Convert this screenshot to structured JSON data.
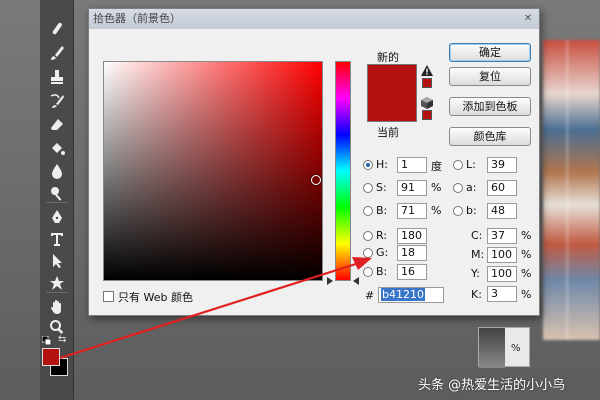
{
  "dialog": {
    "title": "拾色器（前景色）",
    "new_label": "新的",
    "current_label": "当前",
    "web_only_label": "只有 Web 颜色",
    "buttons": {
      "ok": "确定",
      "reset": "复位",
      "add_to_swatches": "添加到色板",
      "color_libraries": "颜色库"
    },
    "hsb": [
      {
        "label": "H:",
        "value": "1",
        "unit": "度",
        "selected": true
      },
      {
        "label": "S:",
        "value": "91",
        "unit": "%",
        "selected": false
      },
      {
        "label": "B:",
        "value": "71",
        "unit": "%",
        "selected": false
      }
    ],
    "rgb": [
      {
        "label": "R:",
        "value": "180"
      },
      {
        "label": "G:",
        "value": "18"
      },
      {
        "label": "B:",
        "value": "16"
      }
    ],
    "lab": [
      {
        "label": "L:",
        "value": "39"
      },
      {
        "label": "a:",
        "value": "60"
      },
      {
        "label": "b:",
        "value": "48"
      }
    ],
    "cmyk": [
      {
        "label": "C:",
        "value": "37",
        "unit": "%"
      },
      {
        "label": "M:",
        "value": "100",
        "unit": "%"
      },
      {
        "label": "Y:",
        "value": "100",
        "unit": "%"
      },
      {
        "label": "K:",
        "value": "3",
        "unit": "%"
      }
    ],
    "hex_label": "#",
    "hex_value": "b41210"
  },
  "colors": {
    "selected": "#b41210",
    "background_swatch": "#000000",
    "annotation_arrow": "#e02020"
  },
  "thumbnail": {
    "percent": "%"
  },
  "watermark": "头条 @热爱生活的小小鸟",
  "icons": [
    "healing-brush-icon",
    "brush-icon",
    "stamp-icon",
    "history-brush-icon",
    "eraser-icon",
    "paint-bucket-icon",
    "blur-icon",
    "dodge-icon",
    "pen-icon",
    "type-icon",
    "path-select-icon",
    "shape-icon",
    "hand-icon",
    "zoom-icon",
    "warning-icon",
    "web-cube-icon"
  ]
}
